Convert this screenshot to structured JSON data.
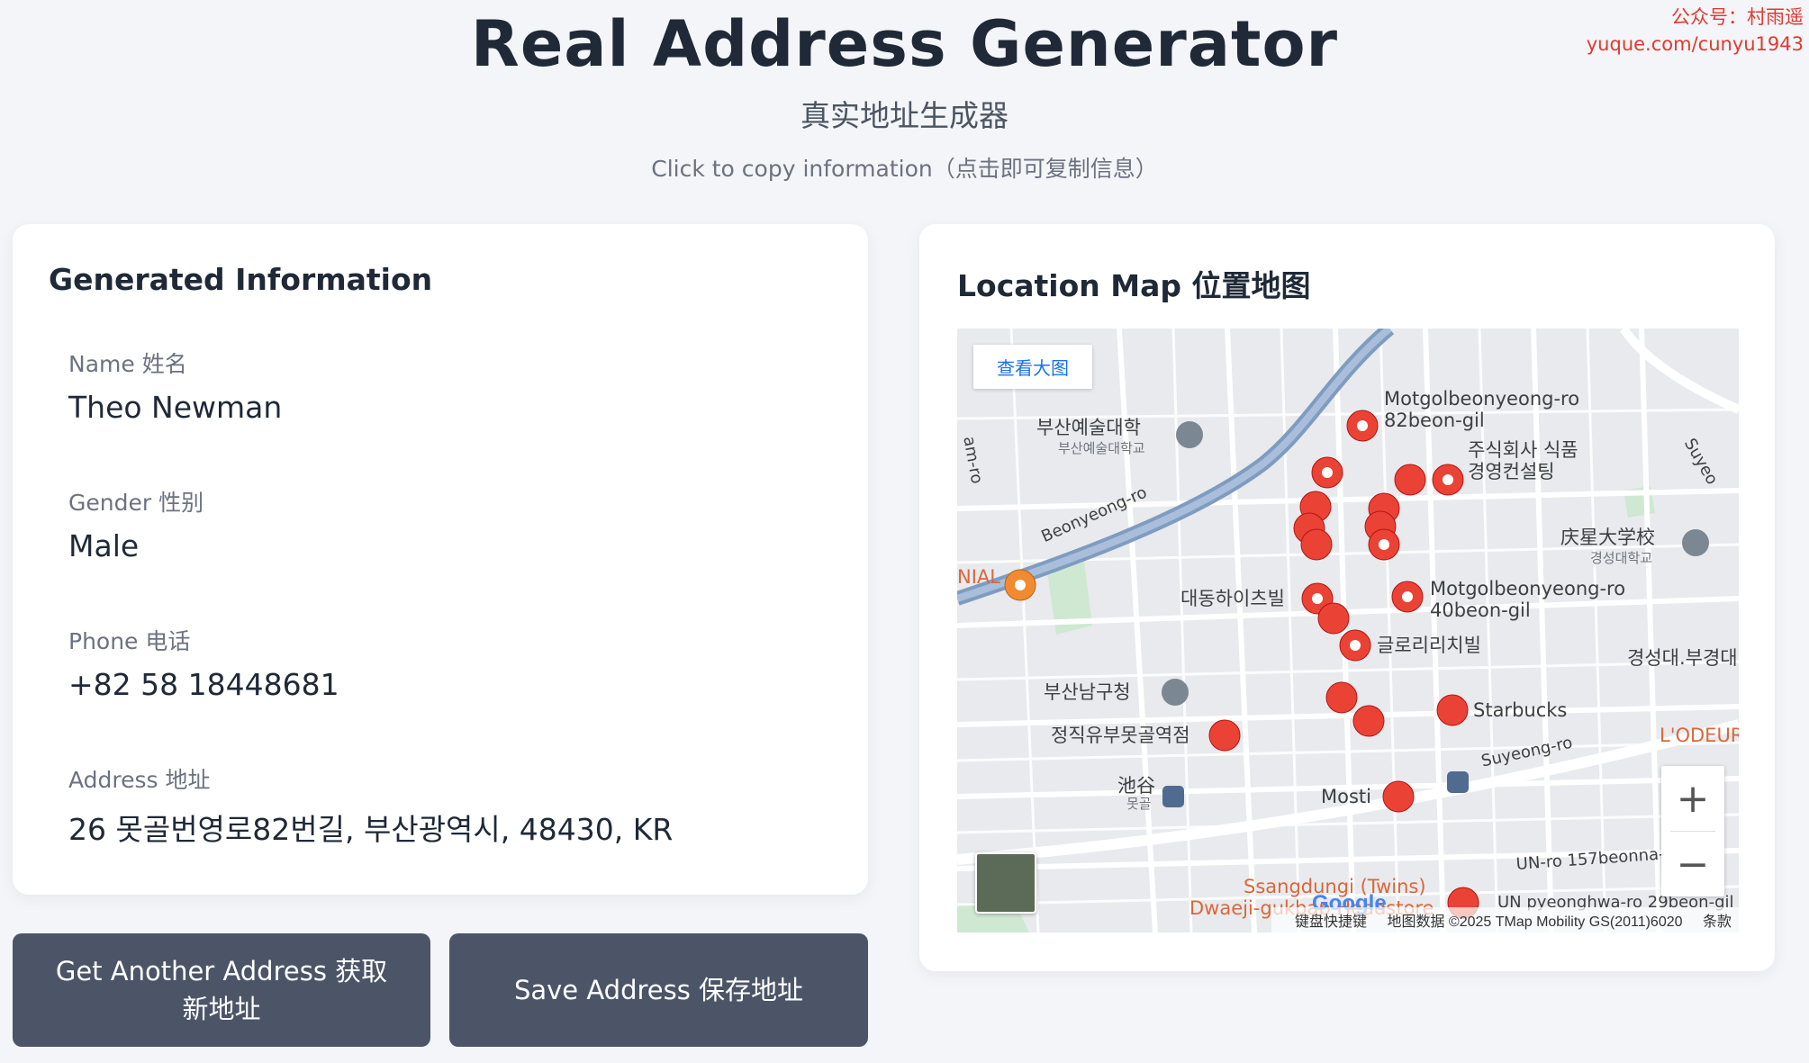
{
  "watermark": {
    "line1": "公众号：村雨遥",
    "line2": "yuque.com/cunyu1943"
  },
  "header": {
    "title": "Real Address Generator",
    "subtitle": "真实地址生成器",
    "hint": "Click to copy information（点击即可复制信息）"
  },
  "info": {
    "title": "Generated Information",
    "fields": [
      {
        "label": "Name 姓名",
        "value": "Theo Newman"
      },
      {
        "label": "Gender 性别",
        "value": "Male"
      },
      {
        "label": "Phone 电话",
        "value": "+82 58 18448681"
      },
      {
        "label": "Address 地址",
        "value": "26 못골번영로82번길, 부산광역시, 48430, KR"
      }
    ]
  },
  "buttons": {
    "get_another": "Get Another Address 获取新地址",
    "save": "Save Address 保存地址"
  },
  "map": {
    "title": "Location Map 位置地图",
    "view_larger": "查看大图",
    "zoom_in": "+",
    "zoom_out": "−",
    "google_logo": "Google",
    "attribution": {
      "shortcuts": "键盘快捷键",
      "data": "地图数据 ©2025 TMap Mobility GS(2011)6020",
      "terms": "条款"
    },
    "labels": {
      "motgol82": "Motgolbeonyeong-ro\n82beon-gil",
      "company": "주식회사 식품\n경영컨설팅",
      "busan_arts": "부산예술대학",
      "busan_arts_sub": "부산예술대학교",
      "kyungsung": "庆星大学校",
      "kyungsung_sub": "경성대학교",
      "beonyeong_ro": "Beonyeong-ro",
      "daedong": "대동하이츠빌",
      "motgol40": "Motgolbeonyeong-ro\n40beon-gil",
      "glory": "글로리리치빌",
      "kyungsung_station": "경성대.부경대",
      "nam_gu_office": "부산남구청",
      "starbucks": "Starbucks",
      "lodeur": "L'ODEUR",
      "jeongjik": "정직유부못골역점",
      "suyeong_ro": "Suyeong-ro",
      "mosti": "Mosti",
      "jigok": "池谷",
      "jigok_sub": "못골",
      "un_ro": "UN-ro 157beonna-",
      "un_pyeonghwa": "UN pyeonghwa-ro 29beon-gil",
      "ssangdungi": "Ssangdungi (Twins)",
      "dwaeji": "Dwaeji-gukbap Headstore",
      "nial": "NIAL",
      "suyeo": "Suyeo",
      "am_ro": "am-ro"
    }
  }
}
